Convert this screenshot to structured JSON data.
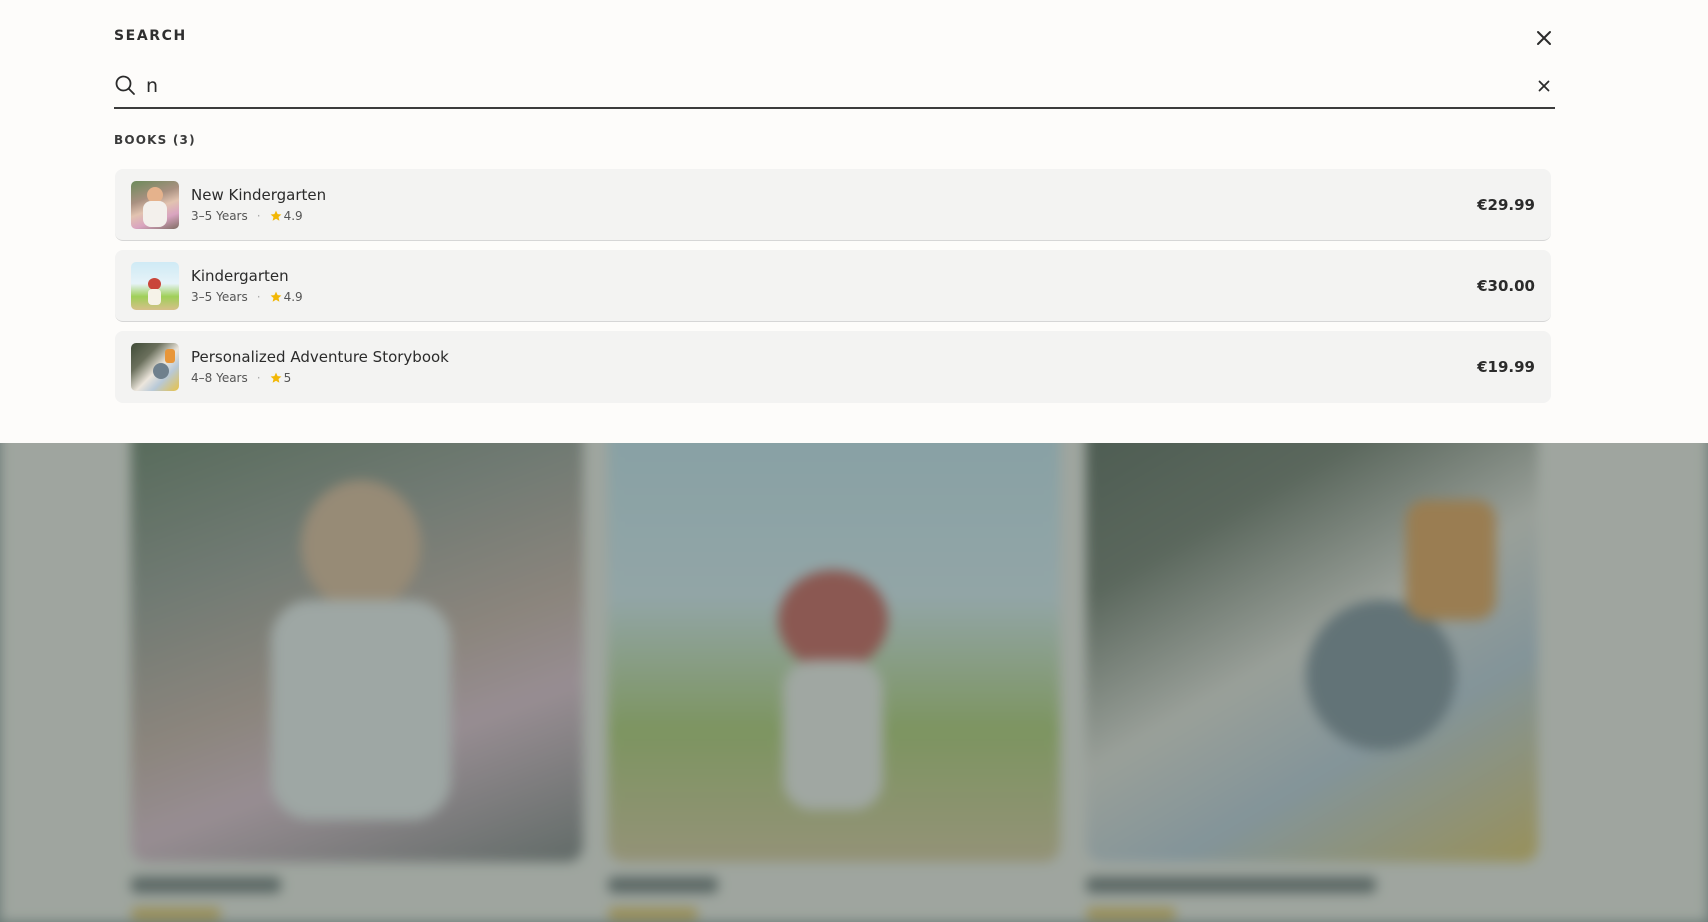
{
  "search": {
    "heading": "SEARCH",
    "query": "n",
    "close_icon": "close-icon",
    "clear_icon": "clear-icon",
    "search_icon": "search-icon"
  },
  "results": {
    "section_label": "BOOKS (3)",
    "items": [
      {
        "title": "New Kindergarten",
        "age": "3–5 Years",
        "rating": "4.9",
        "price": "€29.99"
      },
      {
        "title": "Kindergarten",
        "age": "3–5 Years",
        "rating": "4.9",
        "price": "€30.00"
      },
      {
        "title": "Personalized Adventure Storybook",
        "age": "4–8 Years",
        "rating": "5",
        "price": "€19.99"
      }
    ],
    "meta_separator": "·"
  },
  "colors": {
    "star": "#f2b705",
    "overlay_bg": "#fdfcfa",
    "row_bg": "#f3f3f2",
    "dim": "#5a6966"
  }
}
